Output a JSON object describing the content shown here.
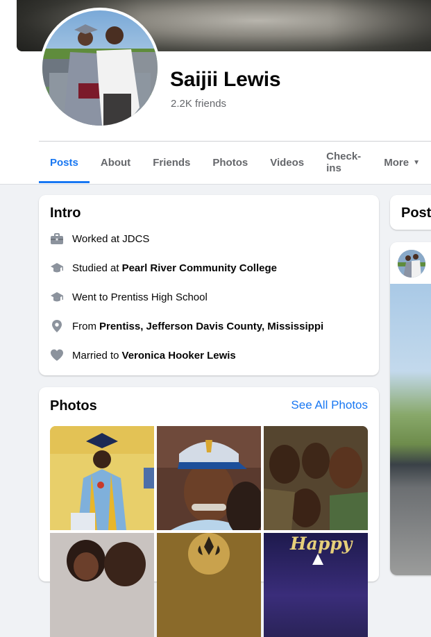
{
  "profile": {
    "name": "Saijii Lewis",
    "friends": "2.2K friends"
  },
  "tabs": [
    {
      "label": "Posts",
      "active": true
    },
    {
      "label": "About"
    },
    {
      "label": "Friends"
    },
    {
      "label": "Photos"
    },
    {
      "label": "Videos"
    },
    {
      "label": "Check-ins"
    },
    {
      "label": "More"
    }
  ],
  "intro": {
    "title": "Intro",
    "items": [
      {
        "icon": "briefcase-icon",
        "prefix": "Worked at JDCS",
        "bold": ""
      },
      {
        "icon": "graduation-cap-icon",
        "prefix": "Studied at ",
        "bold": "Pearl River Community College"
      },
      {
        "icon": "graduation-cap-icon",
        "prefix": "Went to Prentiss High School",
        "bold": ""
      },
      {
        "icon": "location-pin-icon",
        "prefix": "From ",
        "bold": "Prentiss, Jefferson Davis County, Mississippi"
      },
      {
        "icon": "heart-icon",
        "prefix": "Married to ",
        "bold": "Veronica Hooker Lewis"
      }
    ]
  },
  "photos": {
    "title": "Photos",
    "see_all": "See All Photos",
    "happy_text": "Happy"
  },
  "posts": {
    "title": "Posts"
  },
  "colors": {
    "accent": "#1877f2",
    "secondary_text": "#65676b",
    "background": "#f0f2f5"
  }
}
